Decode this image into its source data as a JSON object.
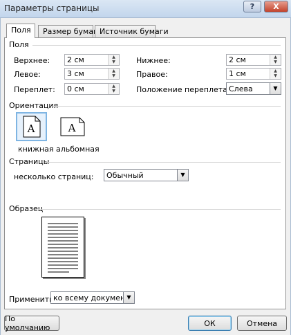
{
  "window": {
    "title": "Параметры страницы",
    "help_glyph": "?",
    "close_glyph": "X"
  },
  "tabs": [
    {
      "label": "Поля"
    },
    {
      "label": "Размер бумаги"
    },
    {
      "label": "Источник бумаги"
    }
  ],
  "margins": {
    "group_label": "Поля",
    "top": {
      "label": "Верхнее:",
      "value": "2 см"
    },
    "bottom": {
      "label": "Нижнее:",
      "value": "2 см"
    },
    "left": {
      "label": "Левое:",
      "value": "3 см"
    },
    "right": {
      "label": "Правое:",
      "value": "1 см"
    },
    "gutter": {
      "label": "Переплет:",
      "value": "0 см"
    },
    "gutter_position": {
      "label": "Положение переплета:",
      "value": "Слева"
    }
  },
  "orientation": {
    "group_label": "Ориентация",
    "portrait": {
      "label": "книжная",
      "glyph": "A",
      "icon": "portrait-page-icon"
    },
    "landscape": {
      "label": "альбомная",
      "glyph": "A",
      "icon": "landscape-page-icon"
    }
  },
  "pages": {
    "group_label": "Страницы",
    "multiple_label": "несколько страниц:",
    "multiple_value": "Обычный"
  },
  "preview": {
    "group_label": "Образец",
    "icon": "page-preview-icon"
  },
  "apply": {
    "label": "Применить:",
    "value": "ко всему документу"
  },
  "buttons": {
    "default": "По умолчанию",
    "ok": "ОК",
    "cancel": "Отмена"
  },
  "colors": {
    "title_bar": "#c2d5ec",
    "close_button": "#c3422b",
    "selection": "#7fb5e3"
  }
}
